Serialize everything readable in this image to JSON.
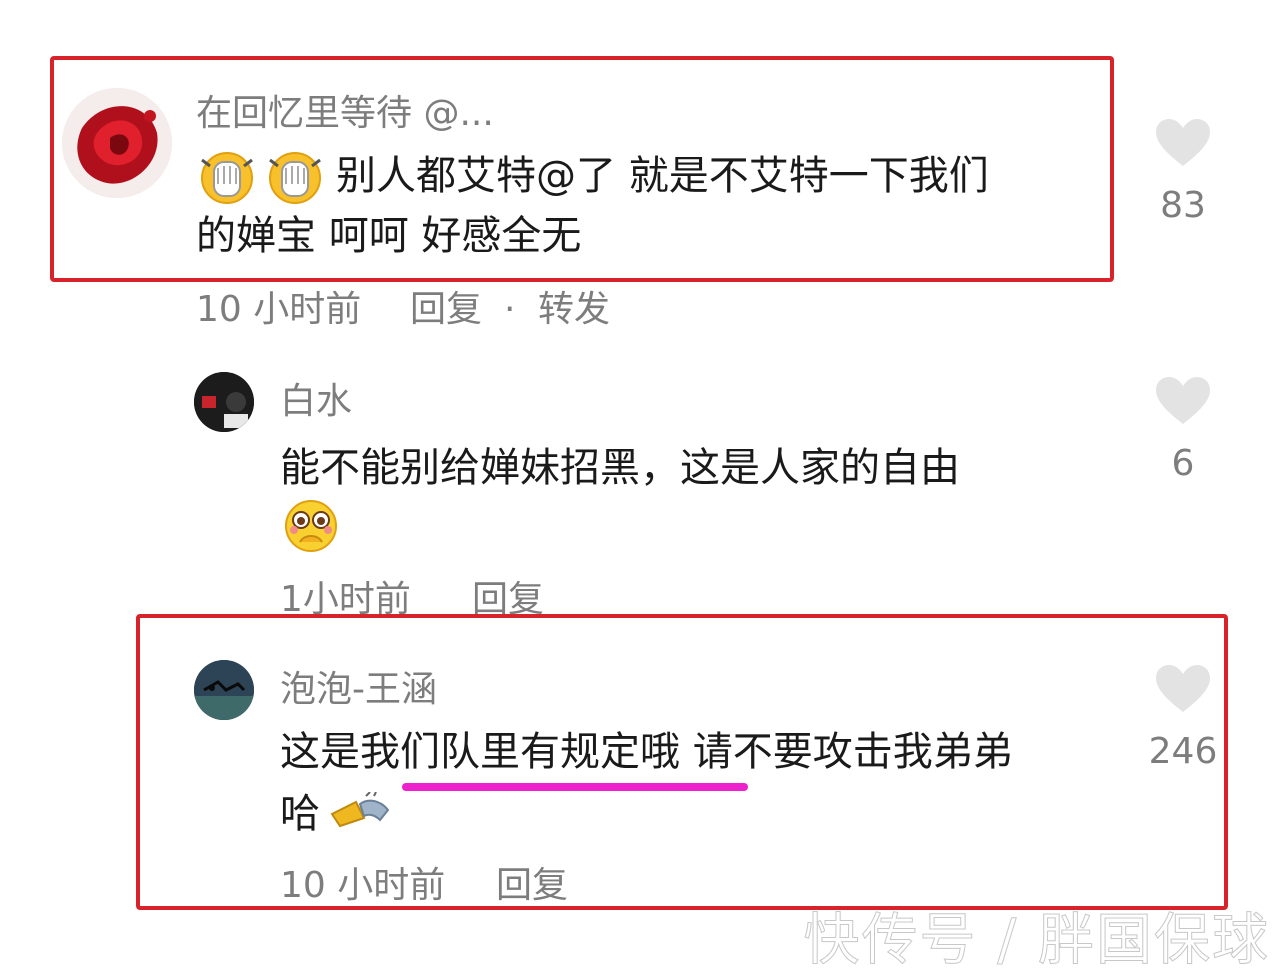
{
  "comments": [
    {
      "username": "在回忆里等待 @...",
      "line1": "别人都艾特@了 就是不艾特一下我们",
      "line2": "的婵宝 呵呵 好感全无",
      "time": "10 小时前",
      "reply": "回复",
      "separator": "·",
      "forward": "转发",
      "likes": "83"
    },
    {
      "username": "白水",
      "line1": "能不能别给婵妹招黑，这是人家的自由",
      "time": "1小时前",
      "reply": "回复",
      "likes": "6"
    },
    {
      "username": "泡泡-王涵",
      "line1_a": "这是",
      "line1_b": "我们队里有规定哦",
      "line1_c": " 请不要攻击我弟弟",
      "line2": "哈",
      "time": "10 小时前",
      "reply": "回复",
      "likes": "246"
    }
  ],
  "watermark": "快传号 / 胖国保球",
  "colors": {
    "highlight_box": "#d8232a",
    "underline": "#ee22cc",
    "secondary_text": "#7d7d7d"
  },
  "icons": [
    "heart-icon",
    "facepalm-emoji",
    "pleading-emoji",
    "hand-emoji"
  ]
}
